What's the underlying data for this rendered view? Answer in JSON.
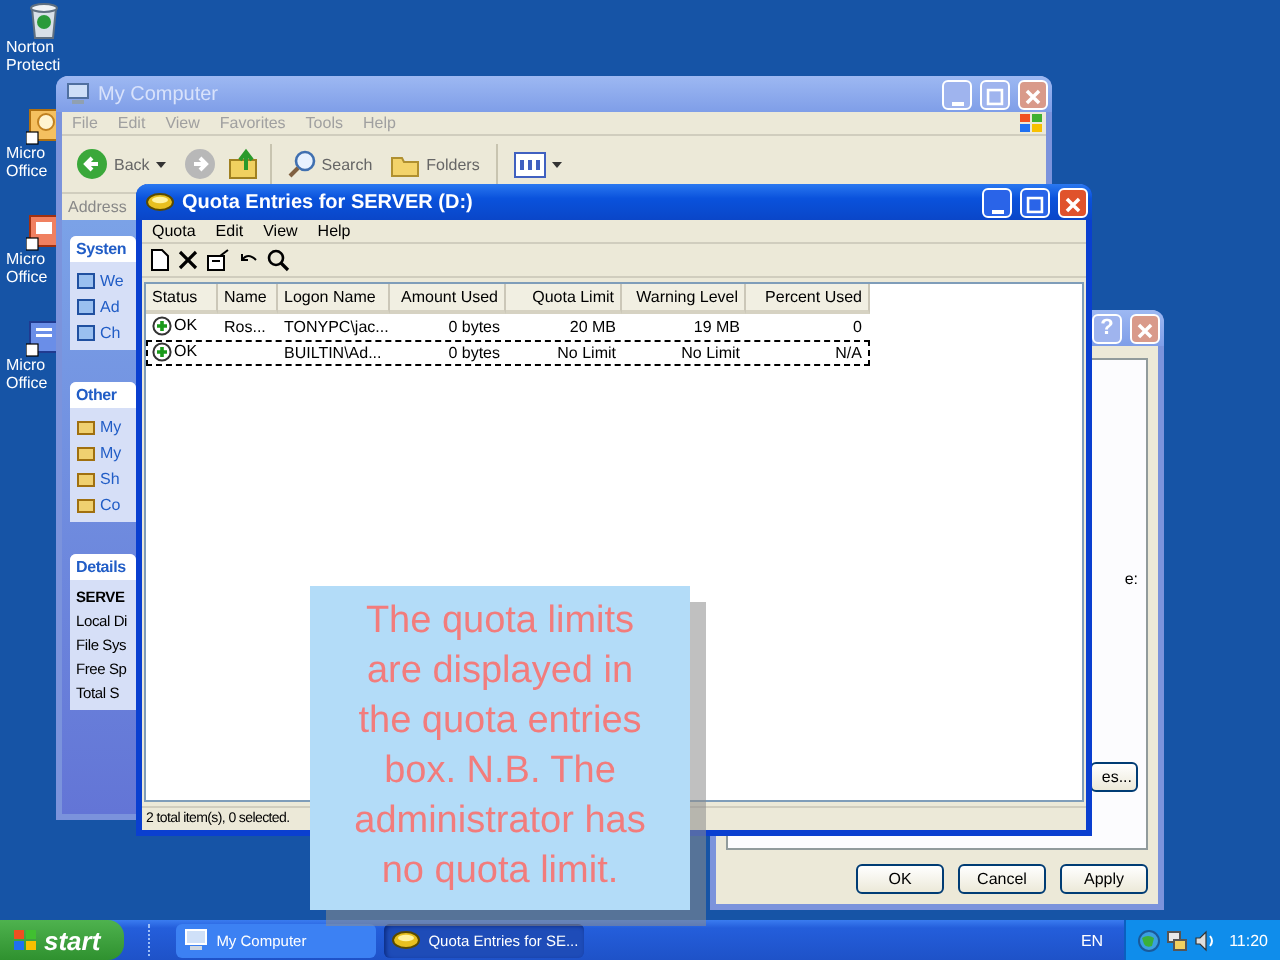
{
  "desktop_icons": [
    {
      "kind": "bin",
      "lines": [
        "Norton",
        "Protecti"
      ]
    },
    {
      "kind": "calendar",
      "lines": [
        "Micro",
        "Office"
      ]
    },
    {
      "kind": "slides",
      "lines": [
        "Micro",
        "Office"
      ]
    },
    {
      "kind": "document",
      "lines": [
        "Micro",
        "Office"
      ]
    }
  ],
  "my_computer_window": {
    "title": "My Computer",
    "active": false,
    "menu": [
      "File",
      "Edit",
      "View",
      "Favorites",
      "Tools",
      "Help"
    ],
    "toolbar": {
      "back": "Back",
      "search": "Search",
      "folders": "Folders"
    },
    "address_label": "Address",
    "panels": [
      {
        "title": "Systen",
        "items": [
          "We",
          "Ad",
          "Ch"
        ]
      },
      {
        "title": "Other",
        "items": [
          "My",
          "My",
          "Sh",
          "Co"
        ]
      },
      {
        "title": "Details",
        "heading": "SERVE",
        "items": [
          "Local Di",
          "File Sys",
          "Free Sp",
          "Total S"
        ]
      }
    ]
  },
  "properties_dialog": {
    "active": false,
    "help_button": "?",
    "partial_label": "e:",
    "partial_button": "es...",
    "buttons": [
      "OK",
      "Cancel",
      "Apply"
    ]
  },
  "quota_window": {
    "title": "Quota Entries for SERVER (D:)",
    "active": true,
    "menu": [
      "Quota",
      "Edit",
      "View",
      "Help"
    ],
    "columns": [
      "Status",
      "Name",
      "Logon Name",
      "Amount Used",
      "Quota Limit",
      "Warning Level",
      "Percent Used"
    ],
    "rows": [
      {
        "status": "OK",
        "name": "Ros...",
        "logon_name": "TONYPC\\jac...",
        "amount_used": "0 bytes",
        "quota_limit": "20 MB",
        "warning_level": "19 MB",
        "percent_used": "0",
        "focused": false
      },
      {
        "status": "OK",
        "logon_name": "BUILTIN\\Ad...",
        "amount_used": "0 bytes",
        "quota_limit": "No Limit",
        "warning_level": "No Limit",
        "percent_used": "N/A",
        "focused": true
      }
    ],
    "status_bar": "2 total item(s), 0 selected."
  },
  "callout": {
    "text": "The quota limits are displayed in the quota entries box. N.B. The administrator has no quota limit."
  },
  "taskbar": {
    "start": "start",
    "tasks": [
      {
        "kind": "computer",
        "label": "My Computer",
        "selected": false
      },
      {
        "kind": "drive",
        "label": "Quota Entries for SE...",
        "selected": true
      }
    ],
    "language": "EN",
    "clock": "11:20"
  }
}
